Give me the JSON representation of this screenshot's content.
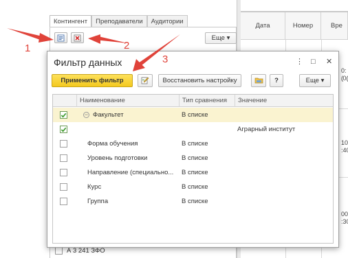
{
  "main": {
    "tabs": [
      {
        "label": "Контингент",
        "active": true
      },
      {
        "label": "Преподаватели",
        "active": false
      },
      {
        "label": "Аудитории",
        "active": false
      }
    ],
    "more_label": "Еще ▾",
    "bottom_row_text": "А 3 241 ЗФО",
    "right_table": {
      "columns": [
        "Дата",
        "Номер",
        "Вре"
      ],
      "times": [
        "0:(",
        ".0(",
        "10:",
        ":40",
        "00:",
        ":30"
      ]
    }
  },
  "dialog": {
    "title": "Фильтр данных",
    "controls": {
      "menu": "⋮",
      "maximize": "□",
      "close": "✕"
    },
    "toolbar": {
      "apply_label": "Применить фильтр",
      "restore_label": "Восстановить настройку",
      "help_label": "?",
      "more_label": "Еще ▾"
    },
    "table": {
      "headers": [
        "Наименование",
        "Тип сравнения",
        "Значение"
      ],
      "rows": [
        {
          "checked": true,
          "name": "Факультет",
          "comparison": "В списке",
          "value": "",
          "group": true
        },
        {
          "checked": true,
          "name": "",
          "comparison": "",
          "value": "Аграрный институт",
          "group": false
        },
        {
          "checked": false,
          "name": "Форма обучения",
          "comparison": "В списке",
          "value": "",
          "group": false
        },
        {
          "checked": false,
          "name": "Уровень подготовки",
          "comparison": "В списке",
          "value": "",
          "group": false
        },
        {
          "checked": false,
          "name": "Направление (специально...",
          "comparison": "В списке",
          "value": "",
          "group": false
        },
        {
          "checked": false,
          "name": "Курс",
          "comparison": "В списке",
          "value": "",
          "group": false
        },
        {
          "checked": false,
          "name": "Группа",
          "comparison": "В списке",
          "value": "",
          "group": false
        }
      ]
    }
  },
  "annotations": {
    "labels": [
      "1",
      "2",
      "3"
    ],
    "color": "#e0433a"
  },
  "colors": {
    "primary_button": "#f4c91f",
    "selected_row": "#faf3d0",
    "checkmark": "#3a9a2a"
  }
}
